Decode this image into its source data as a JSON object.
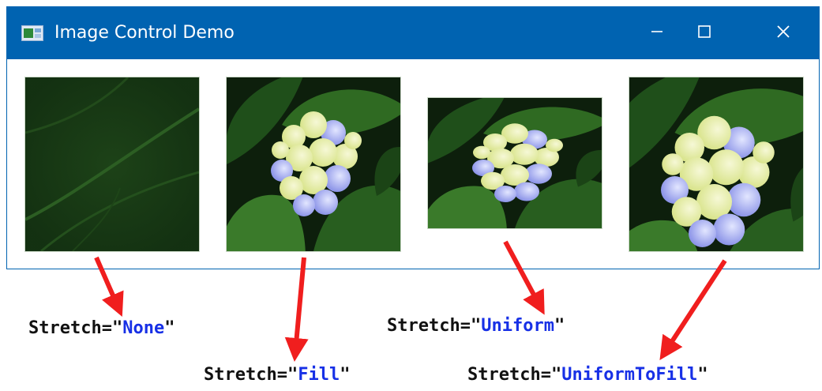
{
  "window": {
    "title": "Image Control Demo",
    "controls": {
      "minimize": "minimize-icon",
      "maximize": "maximize-icon",
      "close": "close-icon"
    }
  },
  "images": [
    {
      "stretch": "None"
    },
    {
      "stretch": "Fill"
    },
    {
      "stretch": "Uniform"
    },
    {
      "stretch": "UniformToFill"
    }
  ],
  "annotations": [
    {
      "prefix": "Stretch=\"",
      "value": "None",
      "suffix": "\""
    },
    {
      "prefix": "Stretch=\"",
      "value": "Fill",
      "suffix": "\""
    },
    {
      "prefix": "Stretch=\"",
      "value": "Uniform",
      "suffix": "\""
    },
    {
      "prefix": "Stretch=\"",
      "value": "UniformToFill",
      "suffix": "\""
    }
  ],
  "colors": {
    "titlebar": "#0063b1",
    "arrow": "#f01e1e",
    "value_text": "#1730e6"
  }
}
